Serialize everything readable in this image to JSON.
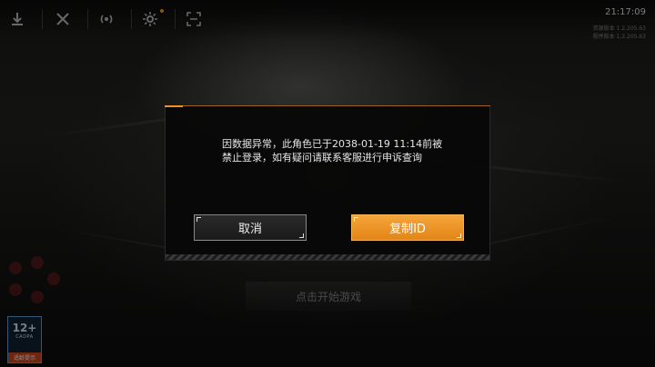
{
  "toolbar": {
    "icons": [
      "download-icon",
      "tools-icon",
      "signal-icon",
      "gear-icon",
      "fullscreen-icon"
    ]
  },
  "status": {
    "time": "21:17:09",
    "version_lines": [
      "资源版本 1.2.205.63",
      "程序版本 1.2.205.63"
    ]
  },
  "dialog": {
    "message": "因数据异常，此角色已于2038-01-19 11:14前被禁止登录，如有疑问请联系客服进行申诉查询",
    "cancel_label": "取消",
    "copy_id_label": "复制ID"
  },
  "start_game_label": "点击开始游戏",
  "age_rating": {
    "age": "12+",
    "org": "CADPA",
    "tip": "适龄提示"
  },
  "colors": {
    "accent": "#f0922a",
    "primary_button": "#e38517"
  }
}
